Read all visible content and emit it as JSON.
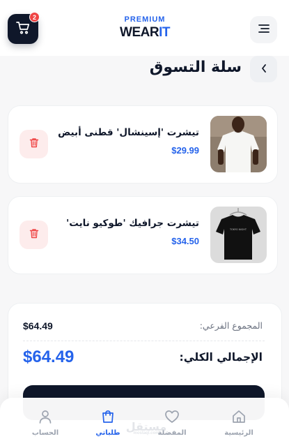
{
  "header": {
    "cart_count": "2",
    "brand_top": "PREMIUM",
    "brand_main": "WEAR",
    "brand_accent": "IT",
    "cart_icon": "cart-icon",
    "menu_icon": "menu-icon"
  },
  "page": {
    "title": "سلة التسوق",
    "back_icon": "chevron-left-icon"
  },
  "items": [
    {
      "name": "تيشرت 'إسينشال' قطنى أبيض",
      "price": "$29.99",
      "image": "white-tshirt"
    },
    {
      "name": "تيشرت جرافيك 'طوكيو نايت'",
      "price": "$34.50",
      "image": "black-tshirt"
    }
  ],
  "summary": {
    "subtotal_label": "المجموع الفرعي:",
    "subtotal_value": "$64.49",
    "total_label": "الإجمالي الكلي:",
    "total_value": "$64.49"
  },
  "nav": {
    "items": [
      {
        "label": "الرئيسية",
        "icon": "home-icon"
      },
      {
        "label": "المفضلة",
        "icon": "heart-icon"
      },
      {
        "label": "طلباتي",
        "icon": "bag-icon",
        "active": true
      },
      {
        "label": "الحساب",
        "icon": "user-icon"
      }
    ]
  },
  "watermark": {
    "text": "مستقل",
    "sub": "mostaql.com"
  },
  "colors": {
    "primary": "#2563eb",
    "dark": "#0f172a",
    "danger": "#ef4444",
    "delete_bg": "#fdecec"
  }
}
